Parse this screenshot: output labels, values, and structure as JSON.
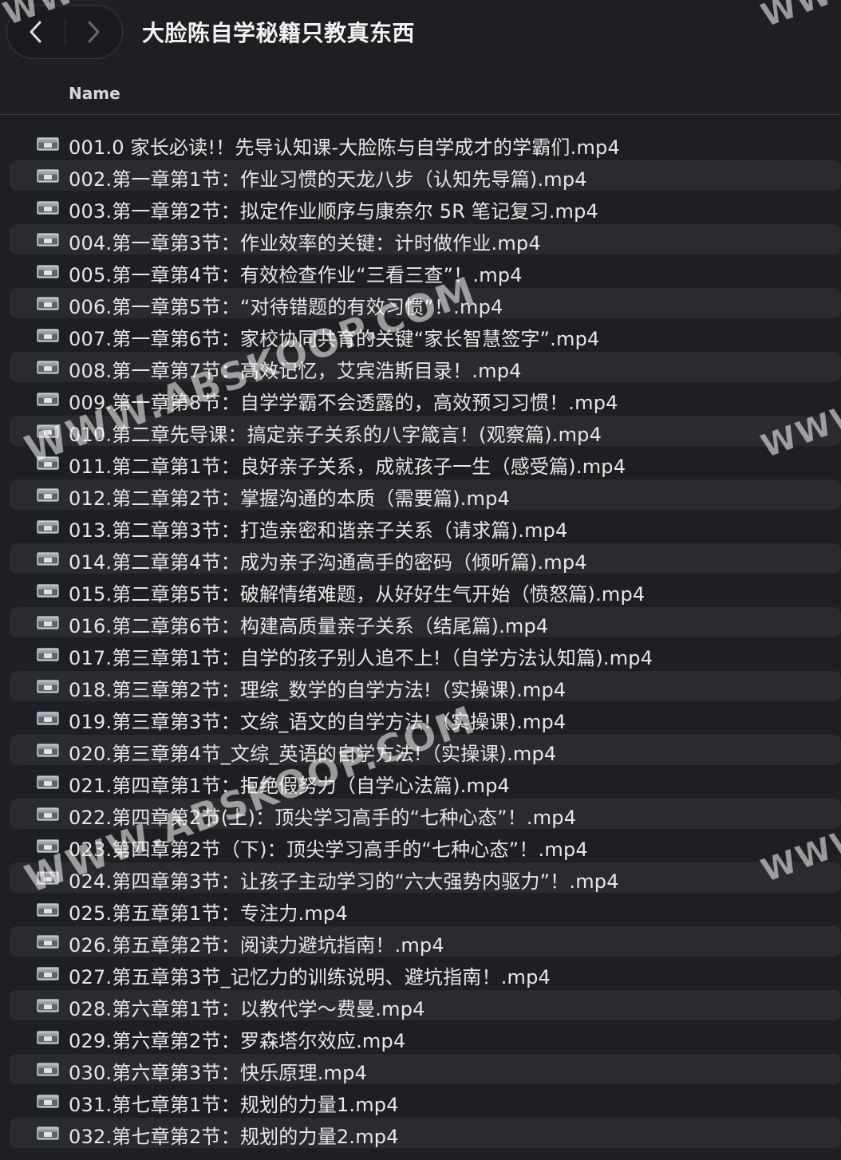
{
  "window": {
    "title": "大脸陈自学秘籍只教真东西"
  },
  "header": {
    "column_name": "Name"
  },
  "files": [
    {
      "name": "001.0 家长必读!！先导认知课-大脸陈与自学成才的学霸们.mp4",
      "icon": "video-file-icon"
    },
    {
      "name": "002.第一章第1节：作业习惯的天龙八步（认知先导篇).mp4",
      "icon": "video-file-icon"
    },
    {
      "name": "003.第一章第2节：拟定作业顺序与康奈尔 5R 笔记复习.mp4",
      "icon": "video-file-icon"
    },
    {
      "name": "004.第一章第3节：作业效率的关键：计时做作业.mp4",
      "icon": "video-file-icon"
    },
    {
      "name": "005.第一章第4节：有效检查作业“三看三查”！.mp4",
      "icon": "video-file-icon"
    },
    {
      "name": "006.第一章第5节：“对待错题的有效习惯”！.mp4",
      "icon": "video-file-icon"
    },
    {
      "name": "007.第一章第6节：家校协同共育的关键“家长智慧签字”.mp4",
      "icon": "video-file-icon"
    },
    {
      "name": "008.第一章第7节：高效记忆，艾宾浩斯目录！.mp4",
      "icon": "video-file-icon"
    },
    {
      "name": "009.第一章第8节：自学学霸不会透露的，高效预习习惯！.mp4",
      "icon": "video-file-icon"
    },
    {
      "name": "010.第二章先导课：搞定亲子关系的八字箴言！(观察篇).mp4",
      "icon": "video-file-icon"
    },
    {
      "name": "011.第二章第1节：良好亲子关系，成就孩子一生（感受篇).mp4",
      "icon": "video-file-icon"
    },
    {
      "name": "012.第二章第2节：掌握沟通的本质（需要篇).mp4",
      "icon": "video-file-icon"
    },
    {
      "name": "013.第二章第3节：打造亲密和谐亲子关系（请求篇).mp4",
      "icon": "video-file-icon"
    },
    {
      "name": "014.第二章第4节：成为亲子沟通高手的密码（倾听篇).mp4",
      "icon": "video-file-icon"
    },
    {
      "name": "015.第二章第5节：破解情绪难题，从好好生气开始（愤怒篇).mp4",
      "icon": "video-file-icon"
    },
    {
      "name": "016.第二章第6节：构建高质量亲子关系（结尾篇).mp4",
      "icon": "video-file-icon"
    },
    {
      "name": "017.第三章第1节：自学的孩子别人追不上!（自学方法认知篇).mp4",
      "icon": "video-file-icon"
    },
    {
      "name": "018.第三章第2节：理综_数学的自学方法!（实操课).mp4",
      "icon": "video-file-icon"
    },
    {
      "name": "019.第三章第3节：文综_语文的自学方法!（实操课).mp4",
      "icon": "video-file-icon"
    },
    {
      "name": "020.第三章第4节_文综_英语的自学方法!（实操课).mp4",
      "icon": "video-file-icon"
    },
    {
      "name": "021.第四章第1节：拒绝假努力（自学心法篇).mp4",
      "icon": "video-file-icon"
    },
    {
      "name": "022.第四章第2节(上)：顶尖学习高手的“七种心态”！.mp4",
      "icon": "video-file-icon"
    },
    {
      "name": "023.第四章第2节（下)：顶尖学习高手的“七种心态”！.mp4",
      "icon": "video-file-icon"
    },
    {
      "name": "024.第四章第3节：让孩子主动学习的“六大强势内驱力”！.mp4",
      "icon": "video-file-icon"
    },
    {
      "name": "025.第五章第1节：专注力.mp4",
      "icon": "video-file-icon"
    },
    {
      "name": "026.第五章第2节：阅读力避坑指南！.mp4",
      "icon": "video-file-icon"
    },
    {
      "name": "027.第五章第3节_记忆力的训练说明、避坑指南！.mp4",
      "icon": "video-file-icon"
    },
    {
      "name": "028.第六章第1节：以教代学～费曼.mp4",
      "icon": "video-file-icon"
    },
    {
      "name": "029.第六章第2节：罗森塔尔效应.mp4",
      "icon": "video-file-icon"
    },
    {
      "name": "030.第六章第3节：快乐原理.mp4",
      "icon": "video-file-icon"
    },
    {
      "name": "031.第七章第1节：规划的力量1.mp4",
      "icon": "video-file-icon"
    },
    {
      "name": "032.第七章第2节：规划的力量2.mp4",
      "icon": "video-file-icon"
    }
  ],
  "watermark": {
    "text": "WWW.ABSKOOP.COM",
    "edge_text": "WWW"
  }
}
